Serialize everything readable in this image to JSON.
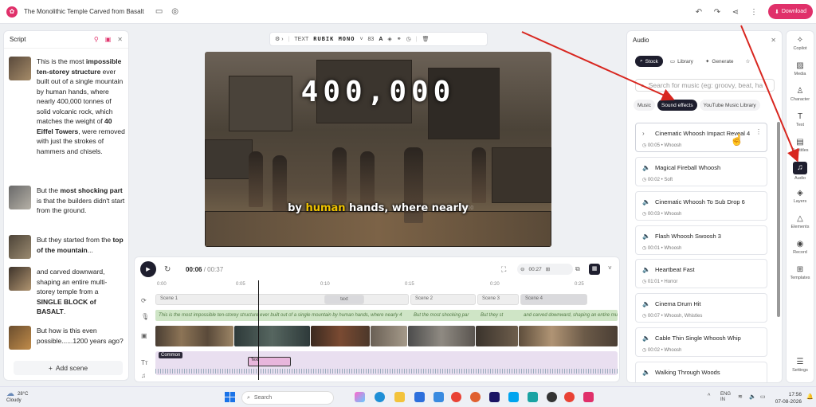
{
  "header": {
    "title": "The Monolithic Temple Carved from Basalt",
    "download_label": "Download"
  },
  "script_panel": {
    "title": "Script",
    "add_scene_label": "Add scene",
    "scenes": [
      {
        "html": "This is the most <b>impossible ten-storey structure</b> ever built out of a single mountain by human hands, where nearly 400,000 tonnes of solid volcanic rock, which matches the weight of <b>40 Eiffel Towers</b>, were removed with just the strokes of hammers and chisels."
      },
      {
        "html": "But the <b>most shocking part</b> is that the builders didn't start from the ground."
      },
      {
        "html": "But they started from the <b>top of the mountain</b>..."
      },
      {
        "html": "and carved downward, shaping an entire multi-storey temple from a <b>SINGLE BLOCK of BASALT</b>."
      },
      {
        "html": "But how is this even possible......1200 years ago?"
      }
    ]
  },
  "text_toolbar": {
    "type_label": "TEXT",
    "font_name": "RUBIK MONO",
    "font_size": "83"
  },
  "video": {
    "big_number": "400,000",
    "caption_pre": "by ",
    "caption_highlight": "human",
    "caption_post": " hands, where nearly",
    "watermark": "400,000"
  },
  "timeline": {
    "current_time": "00:06",
    "total_time": "/ 00:37",
    "zoom_time": "00:27",
    "ruler": [
      "0:00",
      "0:05",
      "0:10",
      "0:15",
      "0:20",
      "0:25"
    ],
    "scenes": [
      "Scene 1",
      "Scene 2",
      "Scene 3",
      "Scene 4"
    ],
    "text_chip": "text",
    "text_segments": [
      "This is the most impossible ten-storey structure ever built out of a single mountain by human hands, where nearly 4",
      "But the most shocking par",
      "But they st",
      "and carved downward, shaping an entire multi-"
    ],
    "common_label": "Common",
    "pink_label": "Text"
  },
  "audio_panel": {
    "title": "Audio",
    "tabs": [
      "Stock",
      "Library",
      "Generate"
    ],
    "search_placeholder": "Search for music (eg: groovy, beat, ha",
    "chips": [
      "Music",
      "Sound effects",
      "YouTube Music Library"
    ],
    "tracks": [
      {
        "name": "Cinematic Whoosh Impact Reveal 4",
        "duration": "00:05",
        "tag": "Whoosh"
      },
      {
        "name": "Magical Fireball Whoosh",
        "duration": "00:02",
        "tag": "Soft"
      },
      {
        "name": "Cinematic Whoosh To Sub Drop 6",
        "duration": "00:03",
        "tag": "Whoosh"
      },
      {
        "name": "Flash Whoosh Swoosh 3",
        "duration": "00:01",
        "tag": "Whoosh"
      },
      {
        "name": "Heartbeat Fast",
        "duration": "01:01",
        "tag": "Horror"
      },
      {
        "name": "Cinema Drum Hit",
        "duration": "00:07",
        "tag": "Whoosh, Whistles"
      },
      {
        "name": "Cable Thin Single Whoosh Whip",
        "duration": "00:02",
        "tag": "Whoosh"
      },
      {
        "name": "Walking Through Woods",
        "duration": "",
        "tag": ""
      }
    ]
  },
  "right_rail": [
    "Copilot",
    "Media",
    "Character",
    "Text",
    "Subtitles",
    "Audio",
    "Layers",
    "Elements",
    "Record",
    "Templates",
    "Settings"
  ],
  "taskbar": {
    "temp": "28°C",
    "weather": "Cloudy",
    "search": "Search",
    "lang1": "ENG",
    "lang2": "IN",
    "time": "17:56",
    "date": "07-08-2026"
  },
  "colors": {
    "accent": "#e0306a",
    "dark": "#1e1e2e",
    "annotation_arrow": "#d8261f"
  }
}
